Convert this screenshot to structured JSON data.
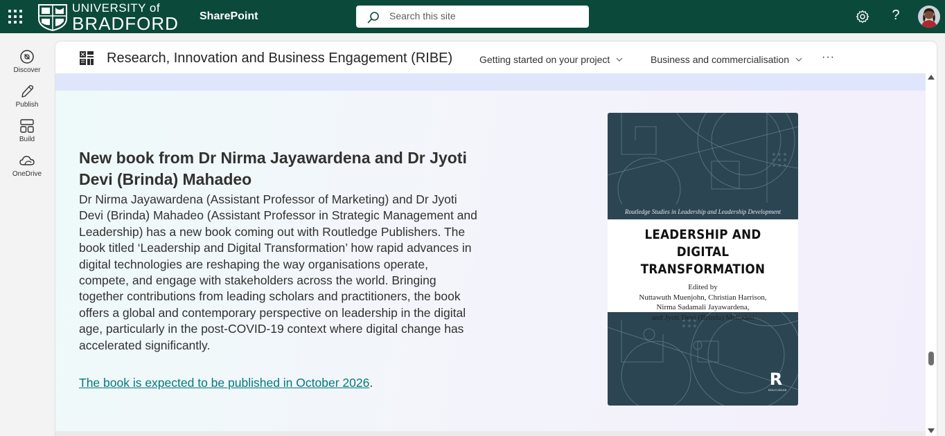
{
  "suitebar": {
    "university_line1": "UNIVERSITY of",
    "university_line2": "BRADFORD",
    "app_name": "SharePoint",
    "search_placeholder": "Search this site",
    "settings_icon": "gear-icon",
    "help_icon": "question-icon",
    "help_glyph": "?"
  },
  "appbar": {
    "items": [
      {
        "label": "Discover",
        "icon": "compass-icon"
      },
      {
        "label": "Publish",
        "icon": "pen-icon"
      },
      {
        "label": "Build",
        "icon": "layout-icon"
      },
      {
        "label": "OneDrive",
        "icon": "cloud-icon"
      }
    ]
  },
  "site": {
    "title": "Research, Innovation and Business Engagement (RIBE)",
    "nav": [
      {
        "label": "Getting started on your project"
      },
      {
        "label": "Business and commercialisation"
      }
    ],
    "more": "···"
  },
  "article": {
    "title": "New book from Dr Nirma Jayawardena and Dr Jyoti Devi (Brinda) Mahadeo",
    "body": "Dr Nirma Jayawardena (Assistant Professor of Marketing) and Dr Jyoti Devi (Brinda) Mahadeo (Assistant Professor in Strategic Management and Leadership) has a new book coming out with Routledge Publishers. The book titled ‘Leadership and Digital Transformation’ how rapid advances in digital technologies are reshaping the way organisations operate, compete, and engage with stakeholders across the world. Bringing together contributions from leading scholars and practitioners, the book offers a global and contemporary perspective on leadership in the digital age, particularly in the post-COVID-19 context where digital change has accelerated significantly.",
    "link_text": "The book is expected to be published in October 2026",
    "link_suffix": "."
  },
  "book_cover": {
    "series": "Routledge Studies in Leadership and Leadership Development",
    "title_line1": "LEADERSHIP AND DIGITAL",
    "title_line2": "TRANSFORMATION",
    "edited_by": "Edited by",
    "editors_line1": "Nuttawuth Muenjohn, Christian Harrison,",
    "editors_line2": "Nirma Sadamali Jayawardena,",
    "editors_line3": "and Jyoti Devi (Brinda) Mahadeo",
    "publisher_mark": "R",
    "publisher_name": "ROUTLEDGE"
  },
  "colors": {
    "suitebar": "#0b4a3b",
    "link": "#03787c",
    "cover": "#2b4553"
  }
}
